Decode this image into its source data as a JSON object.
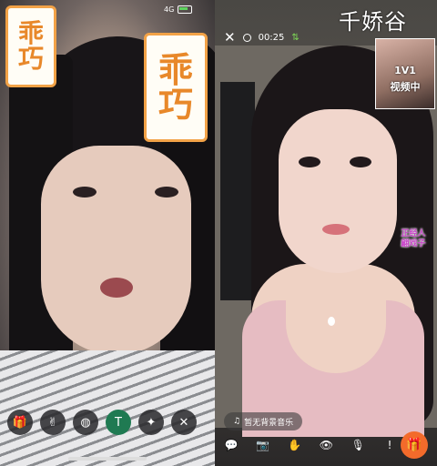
{
  "left_panel": {
    "status": {
      "signal": "4G"
    },
    "badge_small": {
      "line1": "乖",
      "line2": "巧"
    },
    "badge_big": {
      "line1": "乖",
      "line2": "巧"
    },
    "controls": [
      {
        "name": "gift-icon",
        "glyph": "🎁"
      },
      {
        "name": "peace-icon",
        "glyph": "✌"
      },
      {
        "name": "beauty-icon",
        "glyph": "◍"
      },
      {
        "name": "translate-icon",
        "glyph": "T"
      },
      {
        "name": "magic-wand-icon",
        "glyph": "✦"
      },
      {
        "name": "close-icon",
        "glyph": "✕"
      }
    ]
  },
  "right_panel": {
    "watermark": "千娇谷",
    "close_glyph": "✕",
    "timer": "00:25",
    "network_glyph": "⇅",
    "pip": {
      "line1": "1V1",
      "line2": "视频中"
    },
    "sticker": {
      "line1": "正经人",
      "line2": "翩戏子"
    },
    "music": {
      "icon": "♫",
      "label": "暂无背景音乐"
    },
    "bottom_icons": [
      {
        "name": "chat-icon",
        "glyph": "💬"
      },
      {
        "name": "camera-icon",
        "glyph": "📷"
      },
      {
        "name": "hand-icon",
        "glyph": "✋"
      },
      {
        "name": "eye-icon",
        "glyph": "👁"
      },
      {
        "name": "mic-icon",
        "glyph": "🎙"
      },
      {
        "name": "alert-icon",
        "glyph": "!"
      }
    ],
    "gift_glyph": "🎁",
    "accent": "#f36b2b"
  }
}
